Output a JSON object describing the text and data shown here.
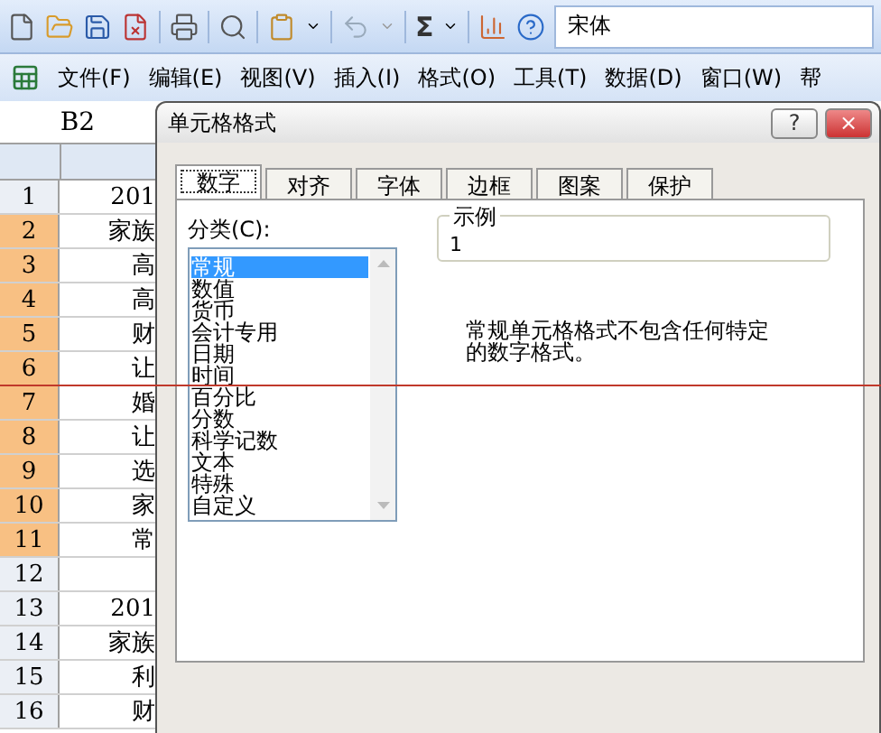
{
  "toolbar": {
    "sum_label": "Σ",
    "font_field": "宋体"
  },
  "menu": [
    "文件(F)",
    "编辑(E)",
    "视图(V)",
    "插入(I)",
    "格式(O)",
    "工具(T)",
    "数据(D)",
    "窗口(W)",
    "帮"
  ],
  "name_box": "B2",
  "rows": [
    {
      "number": "1",
      "cell": "201",
      "selected": false
    },
    {
      "number": "2",
      "cell": "家族",
      "selected": true
    },
    {
      "number": "3",
      "cell": "高",
      "selected": true
    },
    {
      "number": "4",
      "cell": "高",
      "selected": true
    },
    {
      "number": "5",
      "cell": "财",
      "selected": true
    },
    {
      "number": "6",
      "cell": "让",
      "selected": true
    },
    {
      "number": "7",
      "cell": "婚",
      "selected": true
    },
    {
      "number": "8",
      "cell": "让",
      "selected": true
    },
    {
      "number": "9",
      "cell": "选",
      "selected": true
    },
    {
      "number": "10",
      "cell": "家",
      "selected": true
    },
    {
      "number": "11",
      "cell": "常",
      "selected": true
    },
    {
      "number": "12",
      "cell": "",
      "selected": false
    },
    {
      "number": "13",
      "cell": "201",
      "selected": false
    },
    {
      "number": "14",
      "cell": "家族",
      "selected": false
    },
    {
      "number": "15",
      "cell": "利",
      "selected": false
    },
    {
      "number": "16",
      "cell": "财",
      "selected": false
    }
  ],
  "dialog": {
    "title": "单元格格式",
    "help": "?",
    "close": "×",
    "tabs": [
      {
        "label": "数字",
        "selected": true
      },
      {
        "label": "对齐",
        "selected": false
      },
      {
        "label": "字体",
        "selected": false
      },
      {
        "label": "边框",
        "selected": false
      },
      {
        "label": "图案",
        "selected": false
      },
      {
        "label": "保护",
        "selected": false
      }
    ],
    "category_label": "分类(C):",
    "categories": [
      {
        "label": "常规",
        "selected": true
      },
      {
        "label": "数值",
        "selected": false
      },
      {
        "label": "货币",
        "selected": false
      },
      {
        "label": "会计专用",
        "selected": false
      },
      {
        "label": "日期",
        "selected": false
      },
      {
        "label": "时间",
        "selected": false
      },
      {
        "label": "百分比",
        "selected": false
      },
      {
        "label": "分数",
        "selected": false
      },
      {
        "label": "科学记数",
        "selected": false
      },
      {
        "label": "文本",
        "selected": false
      },
      {
        "label": "特殊",
        "selected": false
      },
      {
        "label": "自定义",
        "selected": false
      }
    ],
    "sample": {
      "label": "示例",
      "value": "1"
    },
    "description": "常规单元格格式不包含任何特定的数字格式。"
  }
}
